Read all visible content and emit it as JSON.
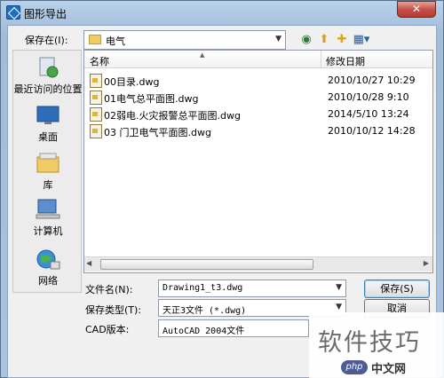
{
  "window": {
    "title": "图形导出",
    "close_label": "✕"
  },
  "lookin": {
    "label": "保存在(I):",
    "value": "电气"
  },
  "toolbar": {
    "back_icon": "back-icon",
    "up_icon": "up-folder-icon",
    "new_folder_icon": "new-folder-icon",
    "views_icon": "views-menu-icon"
  },
  "places": [
    {
      "label": "最近访问的位置",
      "icon": "recent-places-icon"
    },
    {
      "label": "桌面",
      "icon": "desktop-icon"
    },
    {
      "label": "库",
      "icon": "library-icon"
    },
    {
      "label": "计算机",
      "icon": "computer-icon"
    },
    {
      "label": "网络",
      "icon": "network-icon"
    }
  ],
  "list": {
    "columns": [
      "名称",
      "修改日期"
    ],
    "rows": [
      {
        "name": "00目录.dwg",
        "date": "2010/10/27 10:29"
      },
      {
        "name": "01电气总平面图.dwg",
        "date": "2010/10/28 9:10"
      },
      {
        "name": "02弱电.火灾报警总平面图.dwg",
        "date": "2014/5/10 13:24"
      },
      {
        "name": "03 门卫电气平面图.dwg",
        "date": "2010/10/12 14:28"
      }
    ]
  },
  "form": {
    "filename_label": "文件名(N):",
    "filename_value": "Drawing1_t3.dwg",
    "filetype_label": "保存类型(T):",
    "filetype_value": "天正3文件 (*.dwg)",
    "cad_label": "CAD版本:",
    "cad_value": "AutoCAD 2004文件"
  },
  "buttons": {
    "save": "保存(S)",
    "cancel": "取消"
  },
  "watermark": {
    "text": "软件技巧",
    "badge": "php",
    "site": "中文网"
  },
  "colors": {
    "title_gradient": "#b9d1ea",
    "close_red": "#c75050",
    "folder_yellow": "#f2cb63"
  }
}
